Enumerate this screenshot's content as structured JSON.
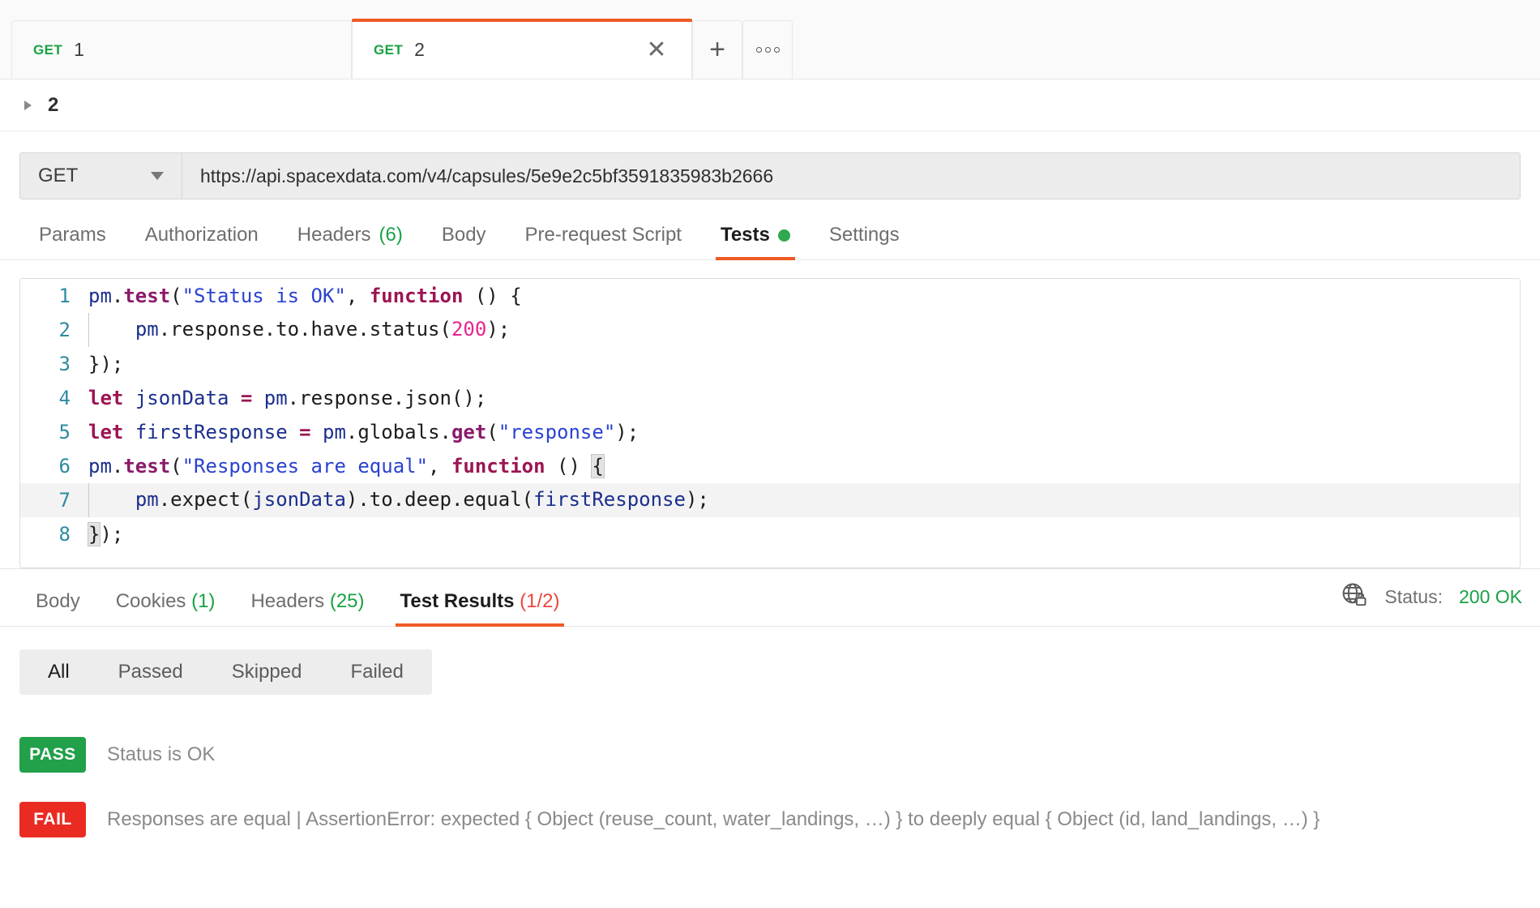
{
  "tabstrip": {
    "tabs": [
      {
        "method": "GET",
        "title": "1",
        "active": false
      },
      {
        "method": "GET",
        "title": "2",
        "active": true
      }
    ],
    "close_glyph": "✕",
    "new_tab_glyph": "+",
    "more_label": "more-options"
  },
  "breadcrumb": {
    "name": "2"
  },
  "urlbar": {
    "method": "GET",
    "url": "https://api.spacexdata.com/v4/capsules/5e9e2c5bf3591835983b2666"
  },
  "request_tabs": [
    {
      "label": "Params",
      "count": "",
      "active": false,
      "dot": false
    },
    {
      "label": "Authorization",
      "count": "",
      "active": false,
      "dot": false
    },
    {
      "label": "Headers",
      "count": "(6)",
      "active": false,
      "dot": false
    },
    {
      "label": "Body",
      "count": "",
      "active": false,
      "dot": false
    },
    {
      "label": "Pre-request Script",
      "count": "",
      "active": false,
      "dot": false
    },
    {
      "label": "Tests",
      "count": "",
      "active": true,
      "dot": true
    },
    {
      "label": "Settings",
      "count": "",
      "active": false,
      "dot": false
    }
  ],
  "editor": {
    "lines": [
      {
        "n": "1",
        "text": "pm.test(\"Status is OK\", function () {"
      },
      {
        "n": "2",
        "text": "    pm.response.to.have.status(200);"
      },
      {
        "n": "3",
        "text": "});"
      },
      {
        "n": "4",
        "text": "let jsonData = pm.response.json();"
      },
      {
        "n": "5",
        "text": "let firstResponse = pm.globals.get(\"response\");"
      },
      {
        "n": "6",
        "text": "pm.test(\"Responses are equal\", function () {"
      },
      {
        "n": "7",
        "text": "    pm.expect(jsonData).to.deep.equal(firstResponse);"
      },
      {
        "n": "8",
        "text": "});"
      }
    ]
  },
  "response_tabs": [
    {
      "label": "Body",
      "count": "",
      "active": false
    },
    {
      "label": "Cookies",
      "count": "(1)",
      "active": false
    },
    {
      "label": "Headers",
      "count": "(25)",
      "active": false
    },
    {
      "label": "Test Results",
      "count": "(1/2)",
      "active": true
    }
  ],
  "status": {
    "icon": "globe-lock-icon",
    "label": "Status:",
    "code": "200 OK"
  },
  "filters": [
    {
      "label": "All",
      "selected": true
    },
    {
      "label": "Passed",
      "selected": false
    },
    {
      "label": "Skipped",
      "selected": false
    },
    {
      "label": "Failed",
      "selected": false
    }
  ],
  "results": [
    {
      "status": "PASS",
      "message": "Status is OK"
    },
    {
      "status": "FAIL",
      "message": "Responses are equal | AssertionError: expected { Object (reuse_count, water_landings, …) } to deeply equal { Object (id, land_landings, …) }"
    }
  ],
  "colors": {
    "accent_orange": "#ef5b25",
    "pass_green": "#22a04a",
    "fail_red": "#ea2b22",
    "count_green": "#1aa244",
    "count_red": "#e8473f"
  }
}
